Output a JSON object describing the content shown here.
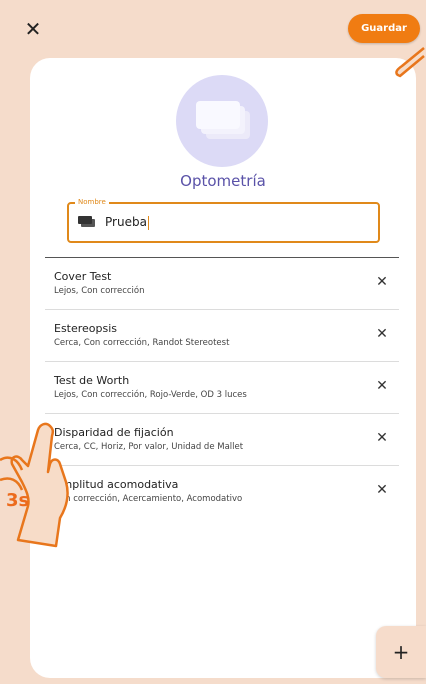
{
  "toolbar": {
    "close_icon": "close-icon",
    "save_label": "Guardar",
    "accent_color": "#f07c12"
  },
  "category": {
    "icon": "cards-stack-icon",
    "title": "Optometría"
  },
  "name_field": {
    "label": "Nombre",
    "value": "Prueba",
    "icon": "card-icon"
  },
  "tests": [
    {
      "name": "Cover Test",
      "detail": "Lejos, Con corrección"
    },
    {
      "name": "Estereopsis",
      "detail": "Cerca, Con corrección, Randot Stereotest"
    },
    {
      "name": "Test de Worth",
      "detail": "Lejos, Con corrección, Rojo-Verde, OD 3 luces"
    },
    {
      "name": "Disparidad de fijación",
      "detail": "Cerca, CC, Horiz, Por valor, Unidad de Mallet"
    },
    {
      "name": "Amplitud acomodativa",
      "detail": "Con corrección, Acercamiento, Acomodativo"
    }
  ],
  "fab": {
    "label": "+"
  },
  "gesture_overlay": {
    "hold_label": "3s"
  }
}
